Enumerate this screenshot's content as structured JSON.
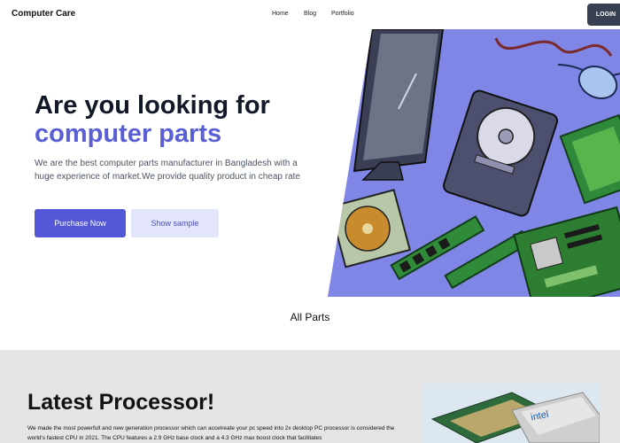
{
  "header": {
    "brand": "Computer Care",
    "nav": [
      {
        "label": "Home"
      },
      {
        "label": "Blog"
      },
      {
        "label": "Portfolio"
      }
    ],
    "login_label": "LOGIN"
  },
  "hero": {
    "title_line1": "Are you looking for",
    "title_line2": "computer parts",
    "description": "We are the best computer parts manufacturer in Bangladesh with a huge experience of market.We provide quality product in cheap rate",
    "primary_button": "Purchase Now",
    "secondary_button": "Show sample",
    "image_alt": "computer parts illustration"
  },
  "parts_section": {
    "title": "All Parts"
  },
  "processor_section": {
    "title": "Latest Processor!",
    "description": "We made the most powerfull and new generation processor which can accelreate your pc speed into 2x desktop PC processor is considered the world's fastest CPU in 2021. The CPU features a 2.9 GHz base clock and a 4.3 GHz max boost clock that facilitates",
    "chip_brand": "intel"
  },
  "colors": {
    "accent": "#5458d8",
    "accent_light": "#e3e5fb",
    "hero_bg": "#7f86e6",
    "login_bg": "#374151",
    "section_bg": "#e5e5e5"
  }
}
